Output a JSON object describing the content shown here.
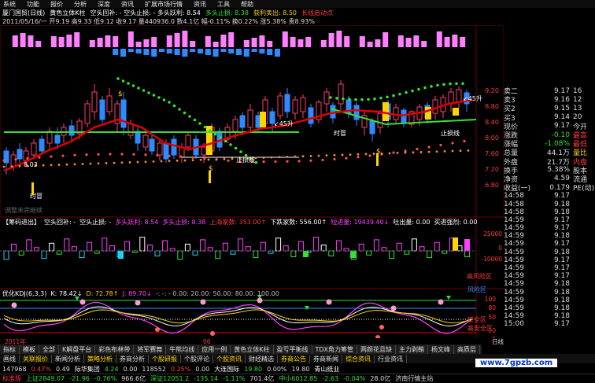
{
  "menu": [
    "系统",
    "功能",
    "报价",
    "分析",
    "深度",
    "资讯",
    "扩展市场行情",
    "资讯",
    "工具",
    "帮助"
  ],
  "window_title": {
    "code": "厦门国贸(日线)",
    "indicator": "黄色立体K柱",
    "ind2": "空头回补: - 空头止损: - 多头跃利: 8.54",
    "ind3": "多头止损: 8.38",
    "ind4": "获利卖出: 8.50",
    "ind5": "长线启动点"
  },
  "info_line": "2011/05/16/一 开9.19 高9.33 低9.12 收9.17 量440936.0 数4.1亿 幅-0.11% 换0.22% 涨5.38% 贵8.93%",
  "price_labels": [
    "9.20",
    "8.80",
    "8.40",
    "8.00",
    "7.60",
    "7.20",
    "6.80"
  ],
  "chart_annotations": {
    "label_803": "8.03",
    "label_shimao": "时冒",
    "label_45sheng_left": "↙45升",
    "label_zhisun_bottom": "止损线",
    "label_45sheng_right": "↙45升",
    "label_zhisun_right": "止损线",
    "label_shimao_right": "时冒",
    "label_yingli": "调整未完继续"
  },
  "kline_markers": {
    "up_icon": "$",
    "down_icon": "$"
  },
  "vol_header": {
    "title": "【筹码进出】",
    "a": "空头回补: -",
    "b": "空头止损: -",
    "c": "多头跃利: 8.54",
    "d": "多头止损: 8.38",
    "e": "上海家数: 353.00↑",
    "f": "下跌家数: 556.00↑",
    "g": "短进量: 19439.40↓",
    "h": "吐出量: 0.00",
    "i": "买进强烈: 0.00"
  },
  "vol_labels": [
    "25000",
    "0",
    "-10000"
  ],
  "kdj_header": {
    "name": "优化KDJ(6,3,3)",
    "k": "K: 78.42↓",
    "d": "D: 72.78↑",
    "j": "J: 89.70↓",
    "rest": "-: -: - 0.00: 20.00: 50.00: 80.00: 100.00"
  },
  "kdj_labels": [
    "100",
    "80",
    "50",
    "20",
    "0"
  ],
  "kdj_zones": {
    "high": "高风险区",
    "risk": "风险区",
    "safe": "安全区",
    "high_safe": "高安全区"
  },
  "year_label": "2011年",
  "month_label": "06",
  "date_label": "日线",
  "quote": {
    "rows": [
      {
        "k": "卖二",
        "v": "9.17",
        "e": "16",
        "c1": "#ddd",
        "c2": "#ddd"
      },
      {
        "k": "卖3",
        "v": "9.16",
        "e": "12",
        "c1": "#ddd",
        "c2": "#ddd"
      },
      {
        "k": "买2",
        "v": "9.15",
        "e": "13",
        "c1": "#ddd",
        "c2": "#ddd"
      },
      {
        "k": "买3",
        "v": "9.14",
        "e": "20",
        "c1": "#ddd",
        "c2": "#ddd"
      },
      {
        "k": "现价",
        "v": "9.17",
        "e": "今开",
        "c1": "#ddd",
        "c2": "#ddd"
      },
      {
        "k": "涨跌",
        "v": "-0.10",
        "e": "最高",
        "c1": "#ddd",
        "c2": "#ff3b3b"
      },
      {
        "k": "涨幅",
        "v": "-1.08%",
        "e": "最低",
        "c1": "#ddd",
        "c2": "#ff3b3b"
      },
      {
        "k": "总量",
        "v": "44.1万",
        "e": "量比",
        "c1": "#ddd",
        "c2": "#ffd400"
      },
      {
        "k": "外盘",
        "v": "21.7万",
        "e": "内盘",
        "c1": "#ddd",
        "c2": "#ff3b3b"
      },
      {
        "k": "换手",
        "v": "5.38%",
        "e": "股本",
        "c1": "#ddd",
        "c2": "#ddd"
      },
      {
        "k": "净资",
        "v": "4.59",
        "e": "流通",
        "c1": "#ddd",
        "c2": "#ddd"
      },
      {
        "k": "收益(一)",
        "v": "0.179",
        "e": "PE(动)",
        "c1": "#ddd",
        "c2": "#ddd"
      }
    ],
    "ticks": [
      {
        "t": "14:58",
        "p": "9.17"
      },
      {
        "t": "14:58",
        "p": "9.18"
      },
      {
        "t": "14:58",
        "p": "9.18"
      },
      {
        "t": "14:59",
        "p": "9.17"
      },
      {
        "t": "14:59",
        "p": "9.17"
      },
      {
        "t": "14:59",
        "p": "9.18"
      },
      {
        "t": "14:59",
        "p": "9.17"
      },
      {
        "t": "14:59",
        "p": "9.18"
      },
      {
        "t": "14:59",
        "p": "9.17"
      },
      {
        "t": "14:59",
        "p": "9.17"
      },
      {
        "t": "14:59",
        "p": "9.17"
      },
      {
        "t": "14:59",
        "p": "9.18"
      },
      {
        "t": "14:59",
        "p": "9.18"
      },
      {
        "t": "14:59",
        "p": "9.18"
      },
      {
        "t": "14:59",
        "p": "9.18"
      },
      {
        "t": "14:59",
        "p": "9.18"
      },
      {
        "t": "15:00",
        "p": "9.17"
      }
    ]
  },
  "tabs1": [
    "指标",
    "模板",
    "全部",
    "K解盘平台",
    "彩色布林带",
    "将军赛舞",
    "牛熊均线",
    "应用一例",
    "黄色立体K柱",
    "盈亏平衡线",
    "TDX角力筹管",
    "两颜花且缺",
    "主力剥鞘",
    "杨文峰",
    "高质层"
  ],
  "tabs2": [
    "画线",
    "关联报价",
    "新闻分析",
    "策略分析",
    "券商分析",
    "个股研报",
    "个股评论",
    "个股资讯",
    "财经精选",
    "券商公告",
    "券商新闻",
    "综合资讯",
    "行业资讯"
  ],
  "ticker": [
    "147968",
    "0.47%",
    "0.49",
    "际华集团",
    "4.24",
    "0.00",
    "118552",
    "0.25%",
    "0.00",
    "大连国际",
    "19.80",
    "0.00%",
    "19.80",
    "青山纸业"
  ],
  "statusbar": [
    "标准版",
    "上证2849.07",
    "-21.96",
    "-0.76%",
    "966.6亿",
    "深证12051.2",
    "-135.14",
    "-1.11%",
    "701.4亿",
    "中小6012.85",
    "-2.63",
    "-0.04%",
    "28.0亿",
    "济南行情主站"
  ],
  "watermark": "www.7gpzb.com",
  "colors": {
    "up": "#ff3b6b",
    "down": "#2e8bff",
    "yellow": "#ffd400",
    "green": "#35e035",
    "red": "#e00000",
    "magenta": "#ff40ff",
    "cyan": "#22d3ee"
  }
}
